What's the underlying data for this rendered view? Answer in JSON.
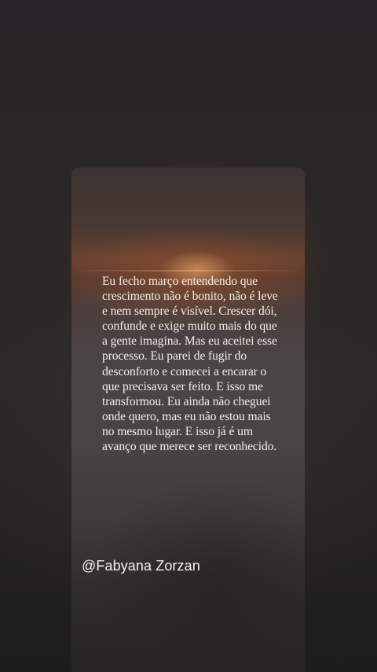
{
  "story": {
    "quote": "Eu fecho março entendendo que crescimento não é bonito, não é leve e nem sempre é visível. Crescer dói, confunde e exige muito mais do que a gente imagina. Mas eu aceitei esse processo. Eu parei de fugir do desconforto e comecei a encarar o que precisava ser feito. E isso me transformou. Eu ainda não cheguei onde quero, mas eu não estou mais no mesmo lugar. E isso já é um avanço que merece ser reconhecido.",
    "author_handle": "@Fabyana Zorzan"
  }
}
